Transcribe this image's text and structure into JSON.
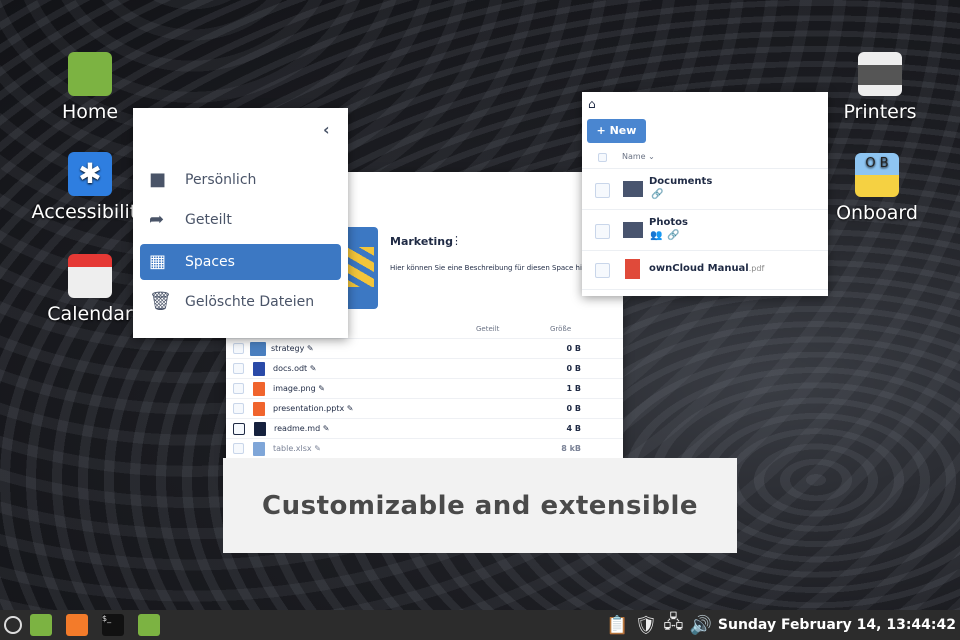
{
  "desktop": {
    "left_icons": [
      {
        "label": "Home"
      },
      {
        "label": "Accessibility"
      },
      {
        "label": "Calendar"
      }
    ],
    "right_icons": [
      {
        "label": "Printers"
      },
      {
        "label": "Onboard"
      }
    ]
  },
  "nav": {
    "items": [
      {
        "label": "Persönlich",
        "icon": "folder-icon"
      },
      {
        "label": "Geteilt",
        "icon": "share-icon"
      },
      {
        "label": "Spaces",
        "icon": "grid-icon",
        "active": true
      },
      {
        "label": "Gelöschte Dateien",
        "icon": "trash-icon"
      }
    ]
  },
  "space": {
    "title": "Marketing",
    "description": "Hier können Sie eine Beschreibung für diesen Space hin",
    "columns": {
      "shared": "Geteilt",
      "size": "Größe"
    },
    "files": [
      {
        "name": "strategy",
        "size": "0 B",
        "type": "folder"
      },
      {
        "name": "docs.odt",
        "size": "0 B",
        "type": "doc"
      },
      {
        "name": "image.png",
        "size": "1 B",
        "type": "image"
      },
      {
        "name": "presentation.pptx",
        "size": "0 B",
        "type": "ppt"
      },
      {
        "name": "readme.md",
        "size": "4 B",
        "type": "text"
      },
      {
        "name": "table.xlsx",
        "size": "8 kB",
        "type": "xls"
      }
    ]
  },
  "filelist": {
    "new_label": "New",
    "name_col": "Name",
    "items": [
      {
        "name": "Documents",
        "ext": ""
      },
      {
        "name": "Photos",
        "ext": ""
      },
      {
        "name": "ownCloud Manual",
        "ext": ".pdf"
      }
    ]
  },
  "banner": {
    "text": "Customizable and extensible"
  },
  "taskbar": {
    "clock": "Sunday February 14, 13:44:42"
  },
  "colors": {
    "accent": "#3c78c3",
    "taskbar": "#2c2c2c"
  }
}
